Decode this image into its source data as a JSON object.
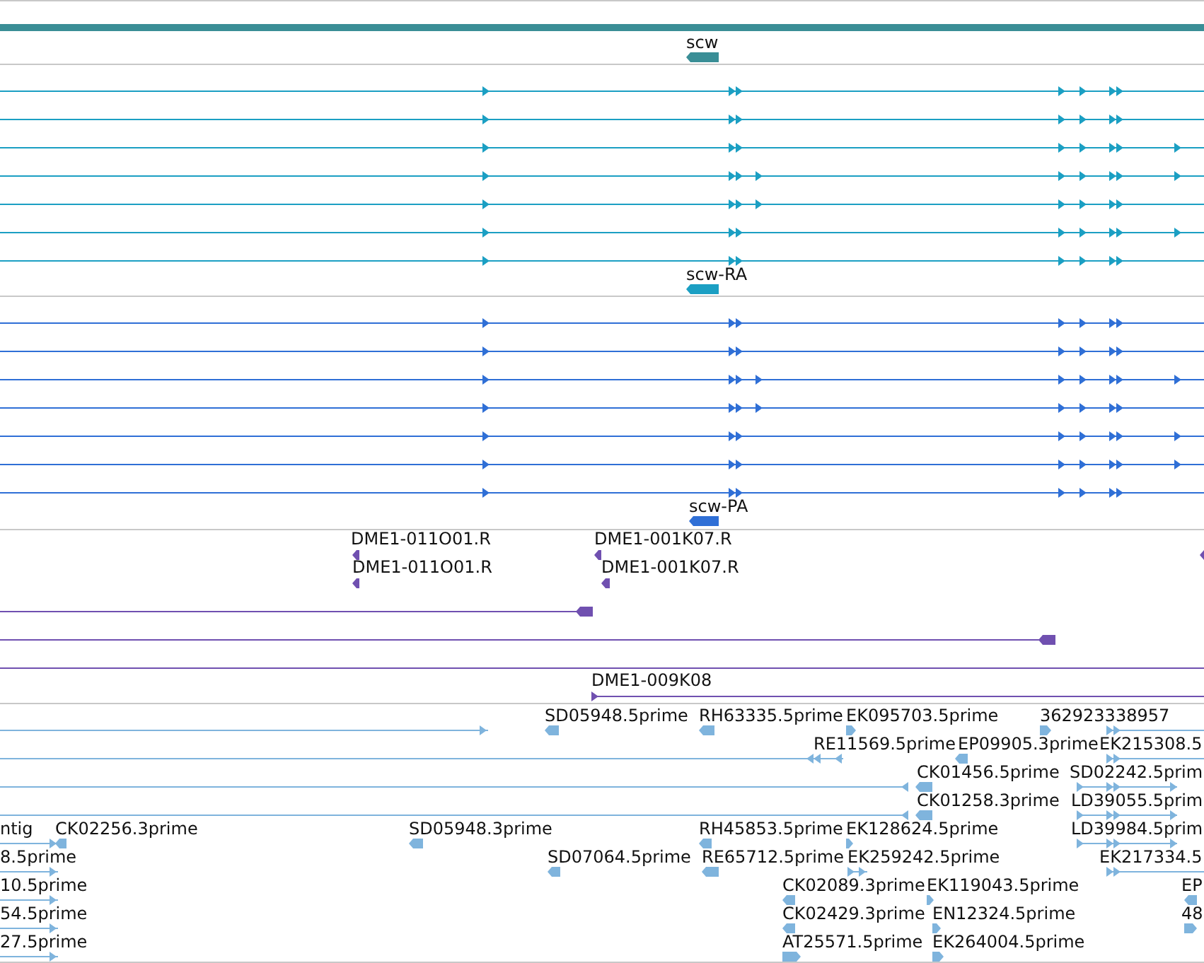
{
  "tracks": [
    {
      "color": "#3a8e96",
      "features": [
        {
          "kind": "bar"
        },
        {
          "kind": "block",
          "label": "scw",
          "reverse": true
        }
      ]
    },
    {
      "color": "#1b9fc3",
      "features": [
        {
          "kind": "transcript",
          "reverse": false
        },
        {
          "kind": "transcript",
          "reverse": false
        },
        {
          "kind": "transcript",
          "reverse": false
        },
        {
          "kind": "transcript",
          "reverse": false
        },
        {
          "kind": "transcript",
          "reverse": false
        },
        {
          "kind": "transcript",
          "reverse": false
        },
        {
          "kind": "transcript",
          "reverse": false
        },
        {
          "kind": "block",
          "label": "scw-RA",
          "reverse": true
        }
      ]
    },
    {
      "color": "#2f6fd6",
      "features": [
        {
          "kind": "transcript",
          "reverse": false
        },
        {
          "kind": "transcript",
          "reverse": false
        },
        {
          "kind": "transcript",
          "reverse": false
        },
        {
          "kind": "transcript",
          "reverse": false
        },
        {
          "kind": "transcript",
          "reverse": false
        },
        {
          "kind": "transcript",
          "reverse": false
        },
        {
          "kind": "transcript",
          "reverse": false
        },
        {
          "kind": "block",
          "label": "scw-PA",
          "reverse": true
        }
      ]
    },
    {
      "color": "#7050b0",
      "features": [
        {
          "kind": "block",
          "label": "DME1-011O01.R",
          "reverse": true
        },
        {
          "kind": "block",
          "label": "DME1-001K07.R",
          "reverse": true
        },
        {
          "kind": "block",
          "reverse": true
        },
        {
          "kind": "block",
          "label": "DME1-011O01.R",
          "reverse": true
        },
        {
          "kind": "block",
          "label": "DME1-001K07.R",
          "reverse": true
        },
        {
          "kind": "line",
          "reverse": true
        },
        {
          "kind": "line",
          "reverse": true
        },
        {
          "kind": "line"
        },
        {
          "kind": "line",
          "label": "DME1-009K08",
          "reverse": false
        }
      ]
    },
    {
      "color": "#7fb4dd",
      "features": [
        {
          "kind": "line",
          "reverse": false
        },
        {
          "kind": "block",
          "label": "SD05948.5prime",
          "reverse": true
        },
        {
          "kind": "block",
          "label": "RH63335.5prime",
          "reverse": true
        },
        {
          "kind": "block",
          "label": "EK095703.5prime",
          "reverse": false
        },
        {
          "kind": "block",
          "label": "362923338957",
          "reverse": false
        },
        {
          "kind": "line",
          "reverse": false
        },
        {
          "kind": "line",
          "label": "RE11569.5prime",
          "reverse": true
        },
        {
          "kind": "block",
          "label": "EP09905.3prime",
          "reverse": true
        },
        {
          "kind": "line",
          "label": "EK215308.5",
          "reverse": false
        },
        {
          "kind": "line",
          "reverse": true
        },
        {
          "kind": "block",
          "label": "CK01456.5prime",
          "reverse": true
        },
        {
          "kind": "line",
          "label": "SD02242.5prim",
          "reverse": false
        },
        {
          "kind": "line",
          "reverse": true
        },
        {
          "kind": "block",
          "label": "CK01258.3prime",
          "reverse": true
        },
        {
          "kind": "line",
          "label": "LD39055.5prim",
          "reverse": false
        },
        {
          "kind": "line",
          "label": "ntig",
          "reverse": false
        },
        {
          "kind": "block",
          "label": "CK02256.3prime",
          "reverse": true
        },
        {
          "kind": "block",
          "label": "SD05948.3prime",
          "reverse": true
        },
        {
          "kind": "block",
          "label": "RH45853.5prime",
          "reverse": true
        },
        {
          "kind": "block",
          "label": "EK128624.5prime",
          "reverse": false
        },
        {
          "kind": "line",
          "label": "LD39984.5prim",
          "reverse": false
        },
        {
          "kind": "line",
          "label": "8.5prime",
          "reverse": false
        },
        {
          "kind": "block",
          "label": "SD07064.5prime",
          "reverse": true
        },
        {
          "kind": "block",
          "label": "RE65712.5prime",
          "reverse": true
        },
        {
          "kind": "line",
          "label": "EK259242.5prime",
          "reverse": false
        },
        {
          "kind": "line",
          "label": "EK217334.5",
          "reverse": false
        },
        {
          "kind": "line",
          "label": "10.5prime",
          "reverse": false
        },
        {
          "kind": "block",
          "label": "CK02089.3prime",
          "reverse": true
        },
        {
          "kind": "block",
          "label": "EK119043.5prime",
          "reverse": false
        },
        {
          "kind": "block",
          "label": "EP",
          "reverse": true
        },
        {
          "kind": "line",
          "label": "54.5prime",
          "reverse": false
        },
        {
          "kind": "block",
          "label": "CK02429.3prime",
          "reverse": true
        },
        {
          "kind": "block",
          "label": "EN12324.5prime",
          "reverse": false
        },
        {
          "kind": "block",
          "label": "48",
          "reverse": false
        },
        {
          "kind": "line",
          "label": "27.5prime",
          "reverse": false
        },
        {
          "kind": "block",
          "label": "AT25571.5prime",
          "reverse": false
        },
        {
          "kind": "block",
          "label": "EK264004.5prime",
          "reverse": false
        }
      ]
    }
  ]
}
